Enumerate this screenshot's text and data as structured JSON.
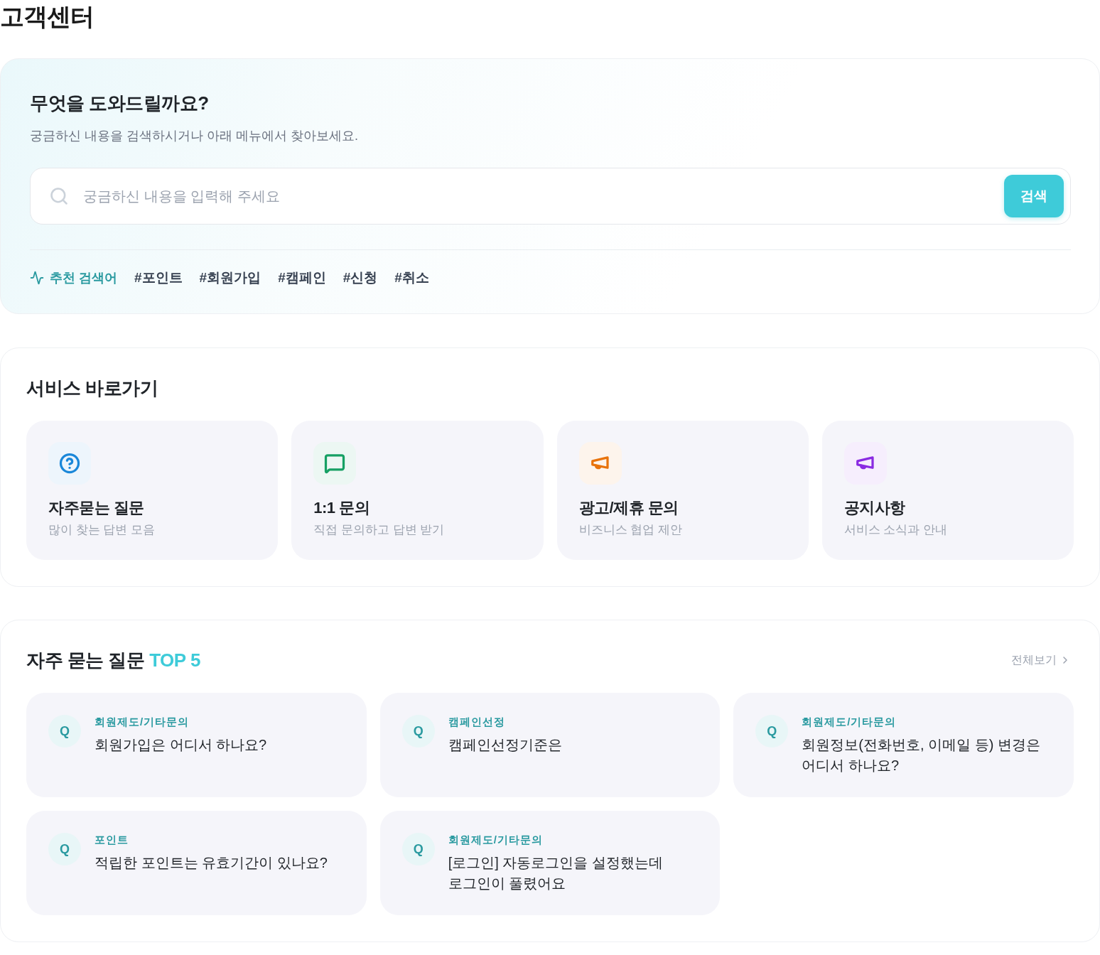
{
  "page_title": "고객센터",
  "search_panel": {
    "title": "무엇을 도와드릴까요?",
    "subtitle": "궁금하신 내용을 검색하시거나 아래 메뉴에서 찾아보세요.",
    "search": {
      "placeholder": "궁금하신 내용을 입력해 주세요",
      "button": "검색"
    },
    "recommended": {
      "label": "추천 검색어",
      "tags": [
        "#포인트",
        "#회원가입",
        "#캠페인",
        "#신청",
        "#취소"
      ]
    }
  },
  "shortcuts": {
    "title": "서비스 바로가기",
    "items": [
      {
        "kind": "question",
        "color": "#1a87d9",
        "title": "자주묻는 질문",
        "subtitle": "많이 찾는 답변 모음"
      },
      {
        "kind": "message",
        "color": "#16a064",
        "title": "1:1 문의",
        "subtitle": "직접 문의하고 답변 받기"
      },
      {
        "kind": "megaphone",
        "color": "#e8730c",
        "title": "광고/제휴 문의",
        "subtitle": "비즈니스 협업 제안"
      },
      {
        "kind": "megaphone",
        "color": "#8a2be2",
        "title": "공지사항",
        "subtitle": "서비스 소식과 안내"
      }
    ]
  },
  "faq": {
    "title": "자주 묻는 질문",
    "highlight": "TOP 5",
    "view_all": "전체보기",
    "items": [
      {
        "badge": "Q",
        "category": "회원제도/기타문의",
        "question": "회원가입은 어디서 하나요?"
      },
      {
        "badge": "Q",
        "category": "캠페인선정",
        "question": "캠페인선정기준은"
      },
      {
        "badge": "Q",
        "category": "회원제도/기타문의",
        "question": "회원정보(전화번호, 이메일 등) 변경은 어디서 하나요?"
      },
      {
        "badge": "Q",
        "category": "포인트",
        "question": "적립한 포인트는 유효기간이 있나요?"
      },
      {
        "badge": "Q",
        "category": "회원제도/기타문의",
        "question": "[로그인] 자동로그인을 설정했는데 로그인이 풀렸어요"
      }
    ]
  }
}
